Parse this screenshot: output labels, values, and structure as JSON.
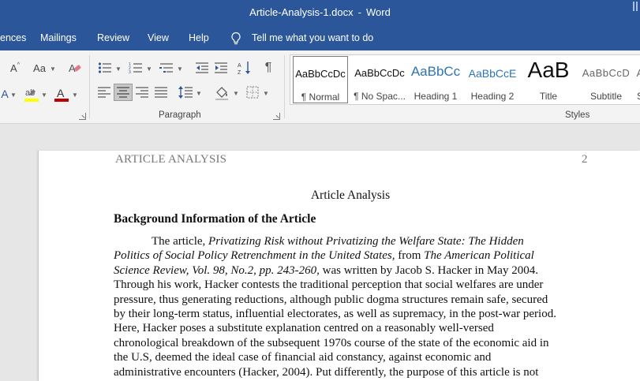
{
  "window": {
    "doc_name": "Article-Analysis-1.docx",
    "separator": "-",
    "app_name": "Word"
  },
  "menu": {
    "tabs": [
      "ences",
      "Mailings",
      "Review",
      "View",
      "Help"
    ],
    "tell_me": "Tell me what you want to do",
    "bg_color": "#2b579a"
  },
  "ribbon": {
    "font_group": {
      "grow_font": "A",
      "change_case": "Aa",
      "font_color_accent": "#c00000",
      "highlight_accent": "#ffff00"
    },
    "paragraph_group": {
      "label": "Paragraph",
      "active_alignment": "center"
    },
    "styles_group": {
      "label": "Styles",
      "items": [
        {
          "preview": "AaBbCcDc",
          "name": "¶ Normal",
          "selected": true
        },
        {
          "preview": "AaBbCcDc",
          "name": "¶ No Spac..."
        },
        {
          "preview": "AaBbCc",
          "name": "Heading 1"
        },
        {
          "preview": "AaBbCcE",
          "name": "Heading 2"
        },
        {
          "preview": "AaB",
          "name": "Title"
        },
        {
          "preview": "AaBbCcD",
          "name": "Subtitle"
        }
      ]
    }
  },
  "document": {
    "running_head": "ARTICLE ANALYSIS",
    "page_number": "2",
    "title": "Article Analysis",
    "heading": "Background Information of the Article",
    "paragraph": {
      "l1_a": "The article, ",
      "l1_b": "Privatizing Risk without Privatizing the Welfare State: The Hidden",
      "l2_a": "Politics of Social Policy Retrenchment in the United States,",
      "l2_b": " from ",
      "l2_c": "The American Political",
      "l3_a": "Science Review, Vol. 98, No.2, pp. 243-260,",
      "l3_b": " was written by Jacob S. Hacker in May 2004.",
      "l4": "Through his work, Hacker contests the traditional perception that social welfares are under",
      "l5": "pressure, thus generating reductions, although public dogma structures remain safe, secured",
      "l6": "by their long-term status, influential electorates, as well as supremacy, in the post-war period.",
      "l7": "Here, Hacker poses a substitute explanation centred on a reasonably well-versed",
      "l8": "chronological breakdown of the subsequent 1970s course of the state of the economic aid in",
      "l9": "the U.S, deemed the ideal case of financial aid constancy, against economic and",
      "l10": "administrative encounters (Hacker, 2004). Put differently, the purpose of this article is not"
    }
  }
}
